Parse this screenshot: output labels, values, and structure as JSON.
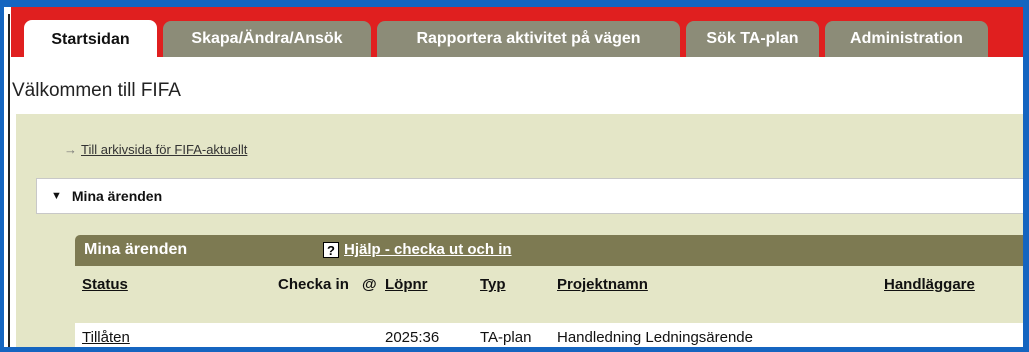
{
  "tabs": [
    {
      "label": "Startsidan",
      "active": true
    },
    {
      "label": "Skapa/Ändra/Ansök",
      "active": false
    },
    {
      "label": "Rapportera aktivitet på vägen",
      "active": false
    },
    {
      "label": "Sök TA-plan",
      "active": false
    },
    {
      "label": "Administration",
      "active": false
    }
  ],
  "page": {
    "welcome": "Välkommen till FIFA",
    "archive_link": "Till arkivsida för FIFA-aktuellt"
  },
  "section": {
    "label": "Mina ärenden"
  },
  "table": {
    "title": "Mina ärenden",
    "help_label": "Hjälp - checka ut och in",
    "help_icon": "?",
    "columns": {
      "status": "Status",
      "checka_in": "Checka in",
      "at": "@",
      "lopnr": "Löpnr",
      "typ": "Typ",
      "projektnamn": "Projektnamn",
      "handlaggare": "Handläggare"
    },
    "rows": [
      {
        "status": "Tillåten",
        "checka_in": "",
        "at": "",
        "lopnr": "2025:36",
        "typ": "TA-plan",
        "projektnamn": "Handledning Ledningsärende",
        "handlaggare": ""
      }
    ]
  },
  "colors": {
    "frame": "#1565c0",
    "tabbar": "#e01f1f",
    "tab_inactive": "#8c8c78",
    "panel": "#e4e6c7",
    "table_header": "#7d7a52"
  }
}
